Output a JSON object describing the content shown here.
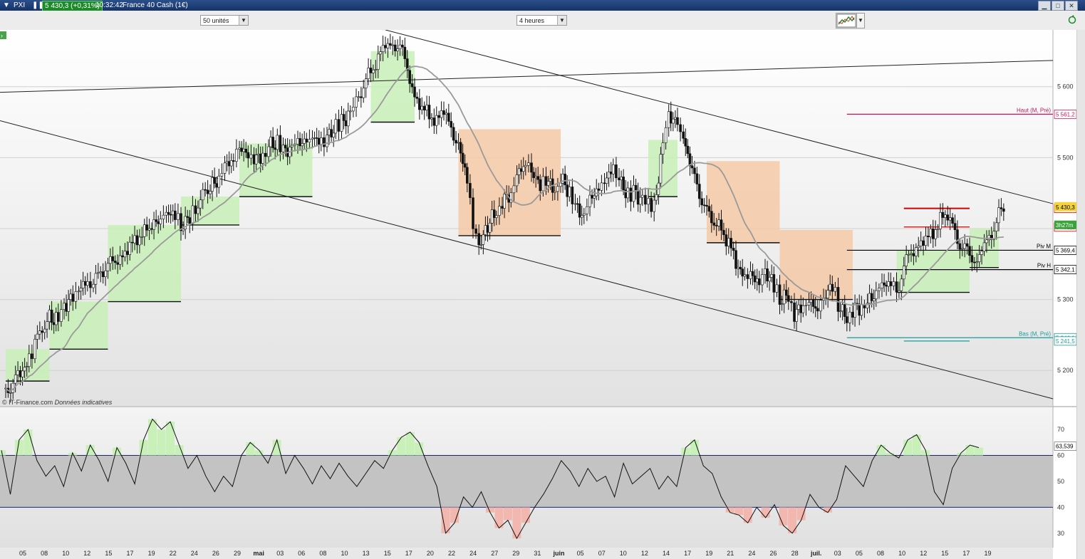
{
  "window": {
    "symbol": "PXI",
    "price_badge": "5 430,3 (+0,31%)",
    "time": "10:32:42",
    "instrument": "France 40 Cash (1€)"
  },
  "toolbar": {
    "units_select": "50 unités",
    "period_select": "4 heures"
  },
  "footer": {
    "source": "© IT-Finance.com",
    "note": "Données indicatives"
  },
  "chart_data": [
    {
      "type": "line",
      "subtype": "candlestick",
      "series": [
        {
          "values": [
            [
              0,
              5170
            ],
            [
              0.5,
              5182
            ],
            [
              1,
              5193
            ],
            [
              1.6,
              5215
            ],
            [
              2,
              5240
            ],
            [
              2.5,
              5262
            ],
            [
              3,
              5275
            ],
            [
              3.6,
              5270
            ],
            [
              4,
              5292
            ],
            [
              4.6,
              5302
            ],
            [
              5,
              5318
            ],
            [
              5.6,
              5322
            ],
            [
              6,
              5323
            ],
            [
              6.5,
              5342
            ],
            [
              7,
              5346
            ],
            [
              7.5,
              5355
            ],
            [
              8,
              5362
            ],
            [
              8.5,
              5373
            ],
            [
              9,
              5388
            ],
            [
              9.5,
              5395
            ],
            [
              10,
              5405
            ],
            [
              10.6,
              5412
            ],
            [
              11,
              5421
            ],
            [
              11.6,
              5420
            ],
            [
              12,
              5400
            ],
            [
              12.6,
              5418
            ],
            [
              13,
              5432
            ],
            [
              13.5,
              5445
            ],
            [
              14,
              5458
            ],
            [
              14.6,
              5470
            ],
            [
              15,
              5488
            ],
            [
              15.6,
              5498
            ],
            [
              16,
              5512
            ],
            [
              16.6,
              5506
            ],
            [
              17,
              5497
            ],
            [
              17.6,
              5503
            ],
            [
              18,
              5516
            ],
            [
              18.6,
              5522
            ],
            [
              19,
              5508
            ],
            [
              19.6,
              5515
            ],
            [
              20,
              5520
            ],
            [
              20.6,
              5524
            ],
            [
              21,
              5529
            ],
            [
              21.6,
              5522
            ],
            [
              22,
              5530
            ],
            [
              22.6,
              5542
            ],
            [
              23,
              5550
            ],
            [
              23.6,
              5562
            ],
            [
              24,
              5578
            ],
            [
              24.5,
              5600
            ],
            [
              25,
              5622
            ],
            [
              25.5,
              5642
            ],
            [
              26,
              5656
            ],
            [
              26.5,
              5662
            ],
            [
              27,
              5652
            ],
            [
              27.5,
              5630
            ],
            [
              28,
              5582
            ],
            [
              28.5,
              5570
            ],
            [
              29,
              5562
            ],
            [
              29.5,
              5550
            ],
            [
              30,
              5568
            ],
            [
              30.5,
              5540
            ],
            [
              31,
              5520
            ],
            [
              31.6,
              5468
            ],
            [
              32,
              5400
            ],
            [
              32.4,
              5375
            ],
            [
              33,
              5405
            ],
            [
              33.6,
              5424
            ],
            [
              34,
              5438
            ],
            [
              34.6,
              5448
            ],
            [
              35,
              5475
            ],
            [
              35.6,
              5492
            ],
            [
              36,
              5478
            ],
            [
              36.6,
              5463
            ],
            [
              37,
              5468
            ],
            [
              37.6,
              5455
            ],
            [
              38,
              5470
            ],
            [
              38.6,
              5452
            ],
            [
              39,
              5430
            ],
            [
              39.6,
              5418
            ],
            [
              40,
              5440
            ],
            [
              40.6,
              5458
            ],
            [
              41,
              5465
            ],
            [
              41.6,
              5488
            ],
            [
              42,
              5470
            ],
            [
              42.6,
              5446
            ],
            [
              43,
              5452
            ],
            [
              43.6,
              5440
            ],
            [
              44,
              5432
            ],
            [
              44.4,
              5428
            ],
            [
              45,
              5520
            ],
            [
              45.4,
              5560
            ],
            [
              46,
              5548
            ],
            [
              46.4,
              5530
            ],
            [
              47,
              5478
            ],
            [
              47.5,
              5452
            ],
            [
              48,
              5423
            ],
            [
              48.5,
              5408
            ],
            [
              49,
              5400
            ],
            [
              49.5,
              5380
            ],
            [
              50,
              5350
            ],
            [
              50.6,
              5330
            ],
            [
              51,
              5338
            ],
            [
              51.6,
              5320
            ],
            [
              52,
              5340
            ],
            [
              52.6,
              5320
            ],
            [
              53,
              5300
            ],
            [
              53.6,
              5305
            ],
            [
              54,
              5280
            ],
            [
              54.6,
              5290
            ],
            [
              55,
              5298
            ],
            [
              55.6,
              5285
            ],
            [
              56,
              5300
            ],
            [
              56.6,
              5322
            ],
            [
              57,
              5290
            ],
            [
              57.6,
              5275
            ],
            [
              58,
              5285
            ],
            [
              58.6,
              5290
            ],
            [
              59,
              5295
            ],
            [
              59.6,
              5310
            ],
            [
              60,
              5318
            ],
            [
              60.6,
              5325
            ],
            [
              61,
              5312
            ],
            [
              61.5,
              5342
            ],
            [
              62,
              5370
            ],
            [
              62.5,
              5374
            ],
            [
              63,
              5385
            ],
            [
              63.5,
              5395
            ],
            [
              64,
              5412
            ],
            [
              64.5,
              5420
            ],
            [
              65,
              5395
            ],
            [
              65.5,
              5371
            ],
            [
              66,
              5364
            ],
            [
              66.5,
              5354
            ],
            [
              67,
              5374
            ],
            [
              67.5,
              5395
            ],
            [
              68,
              5418
            ],
            [
              68.5,
              5430
            ]
          ]
        },
        {
          "name": "",
          "values": []
        }
      ],
      "x_tick_labels": [
        "05",
        "08",
        "10",
        "12",
        "15",
        "17",
        "19",
        "22",
        "24",
        "26",
        "29",
        "mai",
        "03",
        "06",
        "08",
        "10",
        "13",
        "15",
        "17",
        "20",
        "22",
        "24",
        "27",
        "29",
        "31",
        "juin",
        "05",
        "07",
        "10",
        "12",
        "14",
        "17",
        "19",
        "21",
        "24",
        "26",
        "28",
        "juil.",
        "03",
        "05",
        "08",
        "10",
        "12",
        "15",
        "17",
        "19"
      ],
      "y_ticks": [
        5200,
        5300,
        5400,
        5500,
        5600
      ],
      "y_tick_labels": [
        "5 200",
        "5 300",
        "5 400",
        "5 500",
        "5 600"
      ],
      "ylim": [
        5150,
        5680
      ],
      "levels": [
        {
          "label": "Haut (M, Pré)",
          "value_label": "5 561,2",
          "value": 5561.2,
          "color": "#c2185b"
        },
        {
          "label": "",
          "value_label": "5 428,4",
          "value": 5428.4,
          "color": "#d40000"
        },
        {
          "label": "",
          "value_label": "5 402,2",
          "value": 5402.2,
          "color": "#d40000"
        },
        {
          "label": "Piv M",
          "value_label": "5 369,4",
          "value": 5369.4,
          "color": "#000000"
        },
        {
          "label": "Piv H",
          "value_label": "5 342,1",
          "value": 5342.1,
          "color": "#000000"
        },
        {
          "label": "Bas (M, Pré)",
          "value_label": "5 246,1",
          "value": 5246.1,
          "color": "#1a9a9a"
        },
        {
          "label": "",
          "value_label": "5 241,5",
          "value": 5241.5,
          "color": "#1a9a9a"
        }
      ],
      "current_price": {
        "value": 5430.3,
        "label": "5 430,3",
        "countdown": "3h27m"
      }
    },
    {
      "type": "line",
      "series": [
        {
          "values": [
            62,
            45,
            66,
            70,
            58,
            52,
            56,
            48,
            61,
            54,
            64,
            58,
            50,
            63,
            57,
            49,
            66,
            74,
            70,
            73,
            64,
            55,
            60,
            52,
            46,
            52,
            48,
            60,
            65,
            62,
            57,
            66,
            53,
            60,
            55,
            49,
            56,
            51,
            57,
            52,
            48,
            53,
            58,
            55,
            62,
            67,
            69,
            65,
            56,
            48,
            30,
            34,
            44,
            40,
            46,
            38,
            32,
            35,
            28,
            34,
            40,
            45,
            51,
            58,
            54,
            48,
            55,
            50,
            52,
            44,
            57,
            49,
            52,
            55,
            47,
            52,
            48,
            63,
            66,
            56,
            53,
            44,
            38,
            37,
            34,
            40,
            36,
            41,
            33,
            30,
            35,
            45,
            40,
            38,
            43,
            56,
            52,
            48,
            58,
            64,
            61,
            59,
            66,
            68,
            62,
            46,
            41,
            55,
            61,
            64,
            63
          ]
        }
      ],
      "y_ticks": [
        30,
        40,
        50,
        60,
        70
      ],
      "y_tick_labels": [
        "30",
        "40",
        "50",
        "60",
        "70"
      ],
      "ylim": [
        25,
        78
      ],
      "bands": [
        40,
        60
      ],
      "current": {
        "value": 63.539,
        "label": "63,539"
      }
    }
  ]
}
